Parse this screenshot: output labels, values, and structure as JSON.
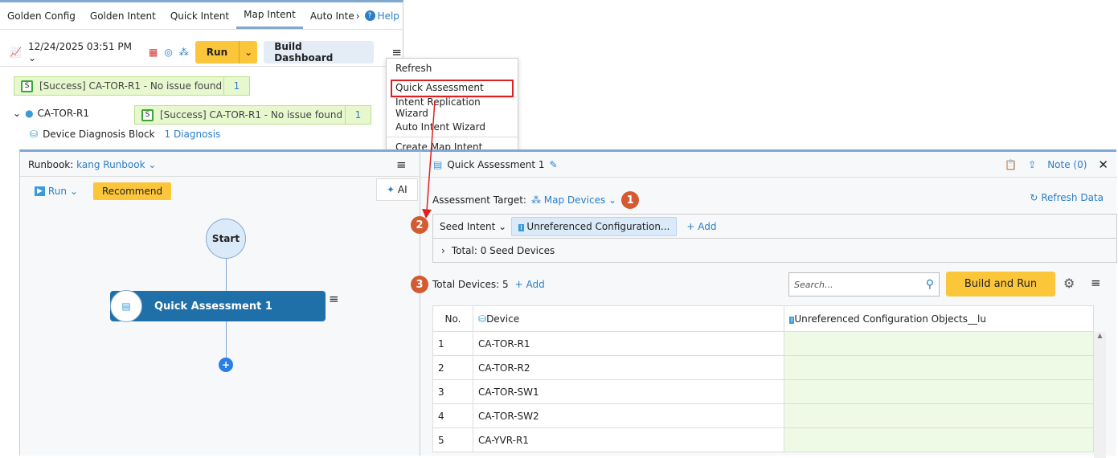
{
  "tabs": [
    "Golden Config",
    "Golden Intent",
    "Quick Intent",
    "Map Intent",
    "Auto Inte"
  ],
  "help": "Help",
  "toolbar": {
    "datetime": "12/24/2025 03:51 PM",
    "run": "Run",
    "build_dashboard": "Build Dashboard"
  },
  "results": {
    "top": {
      "text": "[Success] CA-TOR-R1 - No issue found",
      "count": "1",
      "letter": "S"
    },
    "device": "CA-TOR-R1",
    "device_result": {
      "text": "[Success] CA-TOR-R1 - No issue found",
      "count": "1",
      "letter": "S"
    },
    "block": "Device Diagnosis Block",
    "diagnosis": "1 Diagnosis"
  },
  "menu": [
    "Refresh",
    "Quick Assessment",
    "Intent Replication Wizard",
    "Auto Intent Wizard",
    "Create Map Intent"
  ],
  "runbook": {
    "label": "Runbook:",
    "name": "kang Runbook",
    "run": "Run",
    "recommend": "Recommend",
    "ai": "AI",
    "start": "Start",
    "node": "Quick Assessment 1"
  },
  "qa": {
    "title": "Quick Assessment 1",
    "note": "Note (0)",
    "target_label": "Assessment Target:",
    "target": "Map Devices",
    "refresh": "Refresh Data",
    "seed_intent": "Seed Intent",
    "intent_chip": "Unreferenced Configuration...",
    "add": "+ Add",
    "total_seed": "Total: 0 Seed Devices",
    "total_devices": "Total Devices: 5",
    "add2": "+ Add",
    "search_placeholder": "Search...",
    "build_run": "Build and Run",
    "badges": [
      "1",
      "2",
      "3"
    ],
    "columns": [
      "No.",
      "Device",
      "Unreferenced Configuration Objects__lu"
    ],
    "rows": [
      [
        "1",
        "CA-TOR-R1"
      ],
      [
        "2",
        "CA-TOR-R2"
      ],
      [
        "3",
        "CA-TOR-SW1"
      ],
      [
        "4",
        "CA-TOR-SW2"
      ],
      [
        "5",
        "CA-YVR-R1"
      ]
    ]
  },
  "colors": {
    "accent": "#2a7fc7",
    "run": "#fcc63b",
    "badge": "#d45a32",
    "success_bg": "#e7f8cf"
  }
}
